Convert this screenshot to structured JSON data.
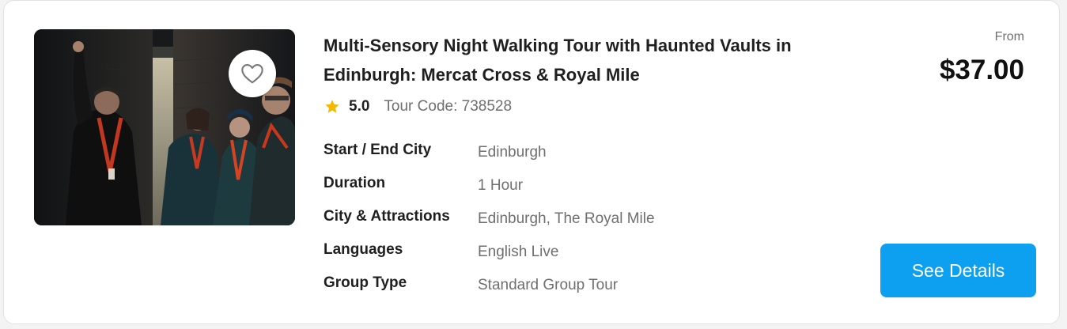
{
  "tour": {
    "title": "Multi-Sensory Night Walking Tour with Haunted Vaults in Edinburgh: Mercat Cross & Royal Mile",
    "rating": "5.0",
    "tour_code": "Tour Code: 738528",
    "image_alt": "Guide with lanyard pointing upward in a narrow dark alley while a group of visitors looks up",
    "favorite_icon": "heart-outline-icon",
    "rating_icon": "star-icon",
    "star_color": "#f5b800",
    "attributes": [
      {
        "label": "Start / End City",
        "value": "Edinburgh"
      },
      {
        "label": "Duration",
        "value": "1 Hour"
      },
      {
        "label": "City & Attractions",
        "value": "Edinburgh, The Royal Mile"
      },
      {
        "label": "Languages",
        "value": "English Live"
      },
      {
        "label": "Group Type",
        "value": "Standard Group Tour"
      }
    ]
  },
  "pricing": {
    "from_label": "From",
    "price": "$37.00"
  },
  "actions": {
    "see_details_label": "See Details",
    "accent_color": "#0ea0f0"
  }
}
